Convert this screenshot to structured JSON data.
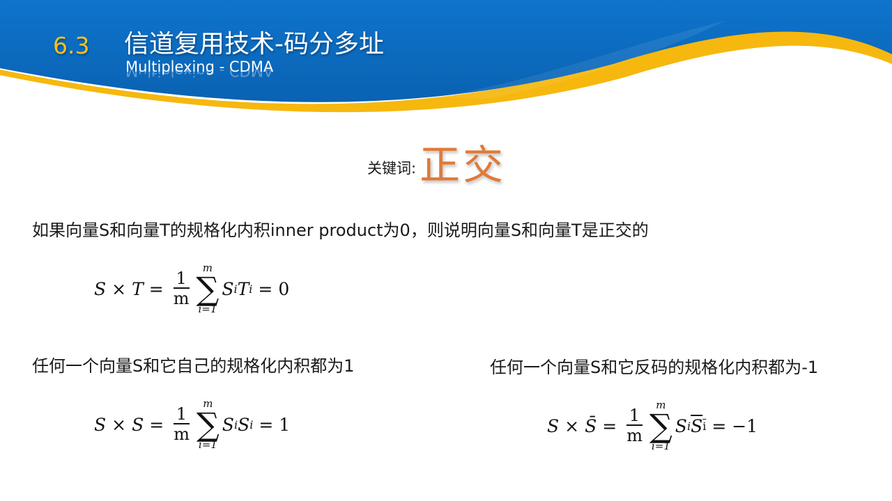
{
  "header": {
    "section_number": "6.3",
    "title": "信道复用技术-码分多址",
    "subtitle": "Multiplexing - CDMA",
    "colors": {
      "banner_blue": "#0B6BC0",
      "accent_gold": "#F6B80E",
      "section_number": "#F3C221"
    }
  },
  "keyword": {
    "label": "关键词:",
    "value": "正交",
    "color": "#E07A38"
  },
  "paragraphs": {
    "p1": "如果向量S和向量T的规格化内积inner product为0，则说明向量S和向量T是正交的",
    "p2": "任何一个向量S和它自己的规格化内积都为1",
    "p3": "任何一个向量S和它反码的规格化内积都为-1"
  },
  "equations": {
    "e1": {
      "lhs_a": "S",
      "op1": "×",
      "lhs_b": "T",
      "eq": "=",
      "frac_num": "1",
      "frac_den": "m",
      "sum_top": "m",
      "sum_bottom": "i=1",
      "term_a": "S",
      "sub_a": "i",
      "term_b": "T",
      "sub_b": "i",
      "eq2": "=",
      "result": "0"
    },
    "e2": {
      "lhs_a": "S",
      "op1": "×",
      "lhs_b": "S",
      "eq": "=",
      "frac_num": "1",
      "frac_den": "m",
      "sum_top": "m",
      "sum_bottom": "i=1",
      "term_a": "S",
      "sub_a": "i",
      "term_b": "S",
      "sub_b": "i",
      "eq2": "=",
      "result": "1"
    },
    "e3": {
      "lhs_a": "S",
      "op1": "×",
      "lhs_b": "S̄",
      "eq": "=",
      "frac_num": "1",
      "frac_den": "m",
      "sum_top": "m",
      "sum_bottom": "i=1",
      "term_a": "S",
      "sub_a": "i",
      "term_b": "S",
      "sub_b": "i",
      "eq2": "=",
      "result": "−1"
    }
  }
}
